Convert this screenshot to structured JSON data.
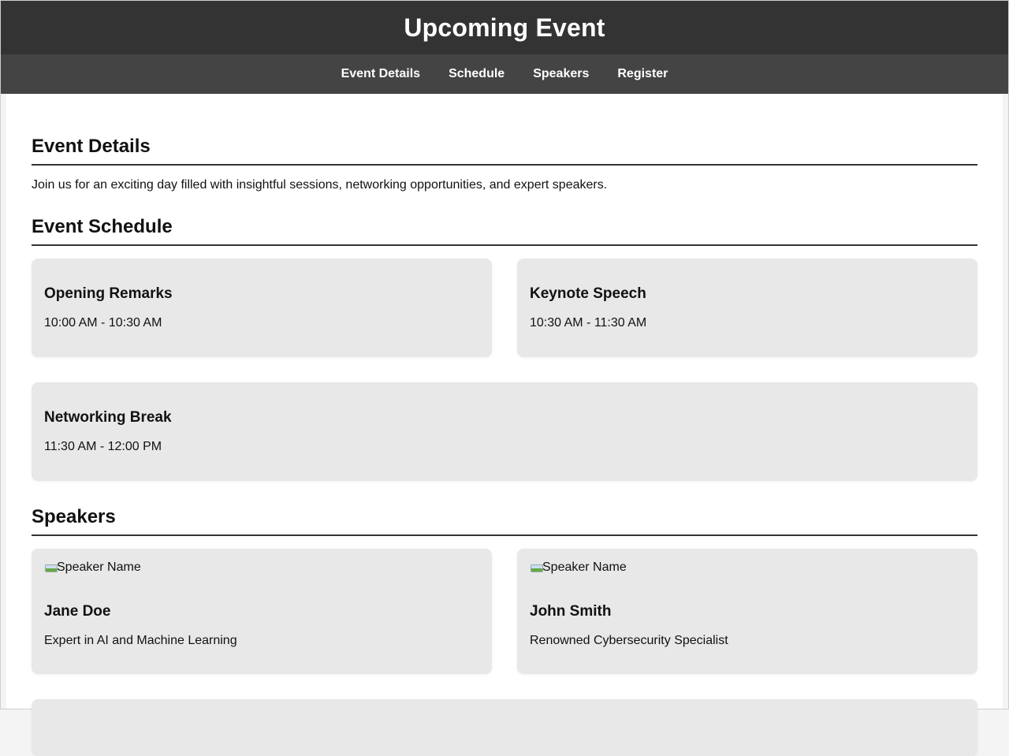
{
  "header": {
    "title": "Upcoming Event"
  },
  "nav": {
    "items": [
      {
        "label": "Event Details"
      },
      {
        "label": "Schedule"
      },
      {
        "label": "Speakers"
      },
      {
        "label": "Register"
      }
    ]
  },
  "details": {
    "title": "Event Details",
    "text": "Join us for an exciting day filled with insightful sessions, networking opportunities, and expert speakers."
  },
  "schedule": {
    "title": "Event Schedule",
    "items": [
      {
        "title": "Opening Remarks",
        "time": "10:00 AM - 10:30 AM"
      },
      {
        "title": "Keynote Speech",
        "time": "10:30 AM - 11:30 AM"
      },
      {
        "title": "Networking Break",
        "time": "11:30 AM - 12:00 PM"
      }
    ]
  },
  "speakers": {
    "title": "Speakers",
    "items": [
      {
        "image_alt": "Speaker Name",
        "name": "Jane Doe",
        "bio": "Expert in AI and Machine Learning"
      },
      {
        "image_alt": "Speaker Name",
        "name": "John Smith",
        "bio": "Renowned Cybersecurity Specialist"
      }
    ]
  }
}
